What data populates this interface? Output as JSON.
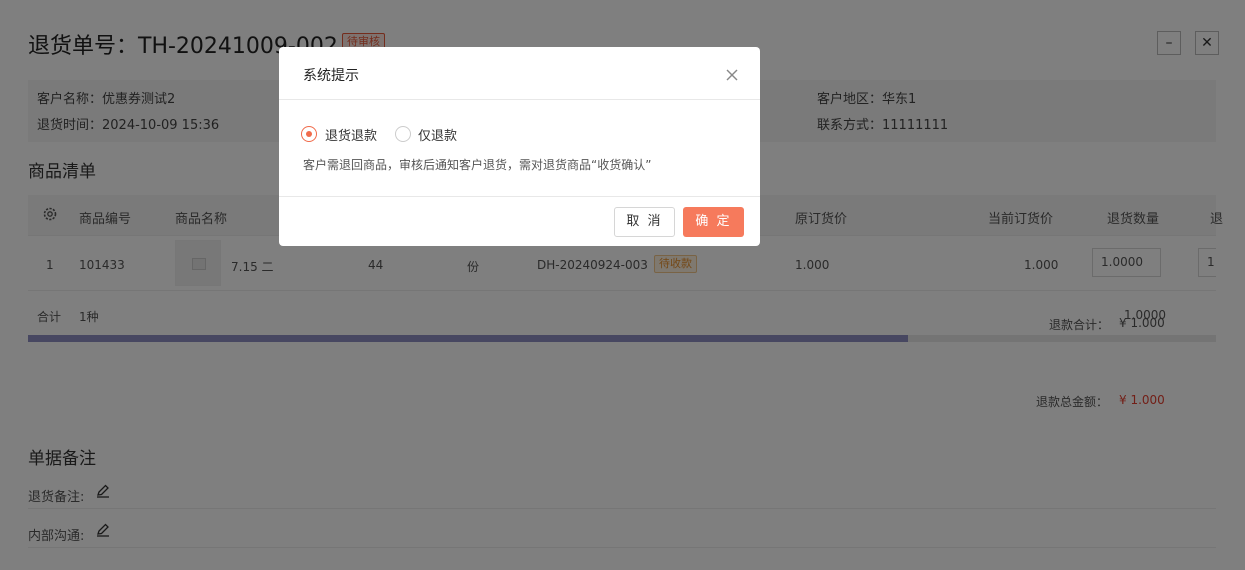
{
  "header": {
    "title": "退货单号：TH-20241009-002",
    "status_badge": "待审核",
    "minimize_label": "–",
    "close_label": "✕"
  },
  "info": {
    "customer_name": "客户名称：优惠券测试2",
    "return_time": "退货时间：2024-10-09 15:36",
    "customer_region": "客户地区：华东1",
    "contact": "联系方式：11111111"
  },
  "product_section": {
    "title": "商品清单",
    "columns": [
      "商品编号",
      "商品名称",
      "原订货价",
      "当前订货价",
      "退货数量",
      "退"
    ],
    "row": {
      "index": "1",
      "code": "101433",
      "name": "7.15 二",
      "qty": "44",
      "unit": "份",
      "order_no": "DH-20240924-003",
      "order_status": "待收款",
      "original_price": "1.000",
      "current_price": "1.000",
      "return_qty": "1.0000",
      "extra": "1"
    },
    "total_label": "合计",
    "total_kinds": "1种",
    "total_qty": "1.0000",
    "refund_subtotal_label": "退款合计：",
    "refund_subtotal": "¥ 1.000",
    "refund_total_label": "退款总金额：",
    "refund_total": "¥ 1.000"
  },
  "notes_section": {
    "title": "单据备注",
    "return_note_label": "退货备注:",
    "internal_note_label": "内部沟通:"
  },
  "dialog": {
    "title": "系统提示",
    "option_return_refund": "退货退款",
    "option_refund_only": "仅退款",
    "selected": "退货退款",
    "description": "客户需退回商品，审核后通知客户退货，需对退货商品“收货确认”",
    "cancel_label": "取 消",
    "confirm_label": "确 定"
  },
  "colors": {
    "accent": "#f67a5c",
    "status_red": "#e85a3a",
    "status_orange": "#e8902c",
    "scroll": "#8e8ec2"
  },
  "scroll": {
    "position_fraction": 0.74
  }
}
